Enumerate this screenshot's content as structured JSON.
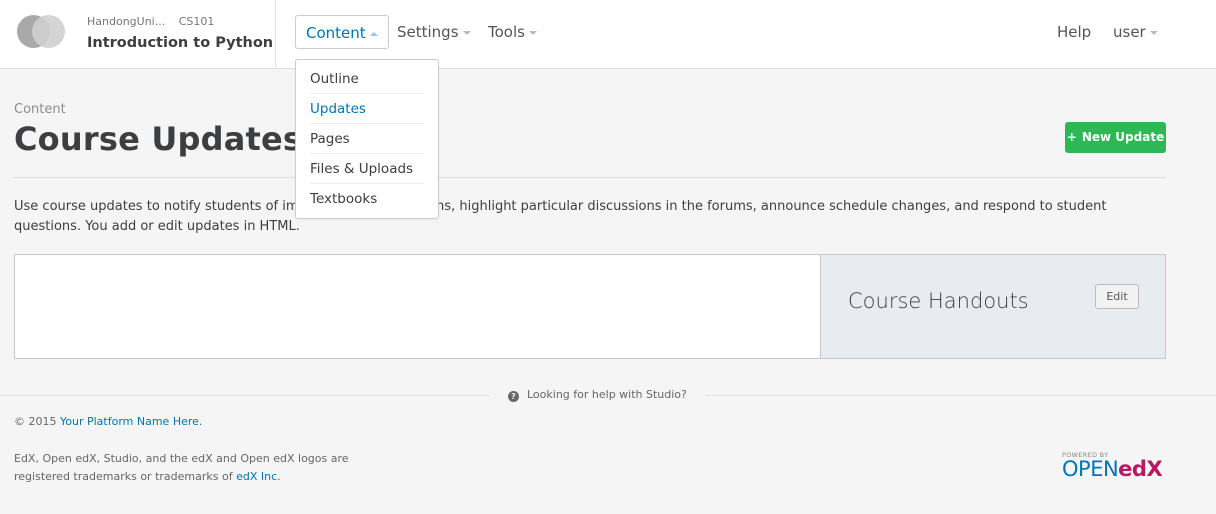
{
  "header": {
    "org": "HandongUni...",
    "course_number": "CS101",
    "course_title": "Introduction to Python",
    "nav": {
      "content": "Content",
      "settings": "Settings",
      "tools": "Tools",
      "help": "Help",
      "user": "user"
    },
    "content_menu": [
      "Outline",
      "Updates",
      "Pages",
      "Files & Uploads",
      "Textbooks"
    ],
    "content_menu_active": "Updates"
  },
  "page": {
    "subtitle": "Content",
    "title": "Course Updates",
    "new_update_button": "New Update",
    "intro_text": "Use course updates to notify students of important dates or exams, highlight particular discussions in the forums, announce schedule changes, and respond to student questions. You add or edit updates in HTML."
  },
  "handouts": {
    "title": "Course Handouts",
    "edit_button": "Edit"
  },
  "footer": {
    "help_text": "Looking for help with Studio?",
    "copyright_prefix": "© 2015",
    "platform_name": "Your Platform Name Here.",
    "legal_text": "EdX, Open edX, Studio, and the edX and Open edX logos are registered trademarks or trademarks of",
    "edx_inc": "edX Inc.",
    "powered_by": "POWERED BY",
    "open": "OPEN",
    "edx": "edX"
  },
  "colors": {
    "accent": "#0075b4",
    "action_green": "#2eb855",
    "handouts_bg": "#e8ecf1"
  }
}
